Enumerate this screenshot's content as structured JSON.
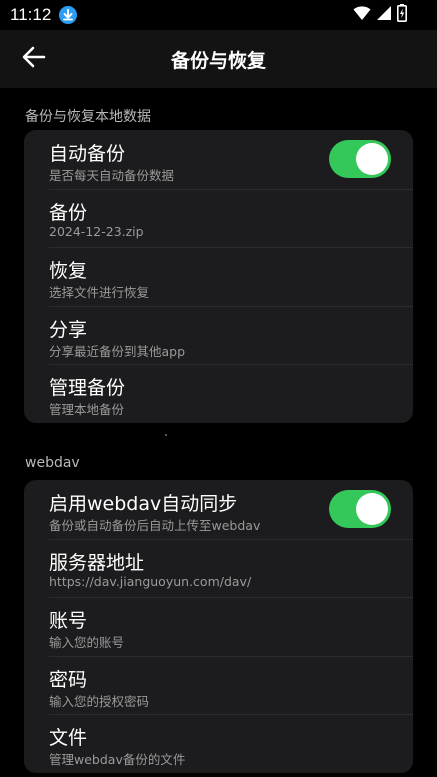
{
  "status_bar": {
    "time": "11:12",
    "download_icon": "download-icon",
    "wifi_icon": "wifi-icon",
    "signal_icon": "signal-icon",
    "battery_icon": "battery-charging-icon"
  },
  "app_bar": {
    "title": "备份与恢复",
    "back_icon": "arrow-left-icon"
  },
  "local_section": {
    "header": "备份与恢复本地数据",
    "items": [
      {
        "title": "自动备份",
        "subtitle": "是否每天自动备份数据",
        "toggle": true
      },
      {
        "title": "备份",
        "subtitle": "2024-12-23.zip"
      },
      {
        "title": "恢复",
        "subtitle": "选择文件进行恢复"
      },
      {
        "title": "分享",
        "subtitle": "分享最近备份到其他app"
      },
      {
        "title": "管理备份",
        "subtitle": "管理本地备份"
      }
    ]
  },
  "webdav_section": {
    "header": "webdav",
    "items": [
      {
        "title": "启用webdav自动同步",
        "subtitle": "备份或自动备份后自动上传至webdav",
        "toggle": true
      },
      {
        "title": "服务器地址",
        "subtitle": "https://dav.jianguoyun.com/dav/"
      },
      {
        "title": "账号",
        "subtitle": "输入您的账号"
      },
      {
        "title": "密码",
        "subtitle": "输入您的授权密码"
      },
      {
        "title": "文件",
        "subtitle": "管理webdav备份的文件"
      }
    ]
  },
  "colors": {
    "background": "#000000",
    "card": "#1c1c1e",
    "toggle_on": "#34c759",
    "download_badge": "#2a9df4"
  }
}
